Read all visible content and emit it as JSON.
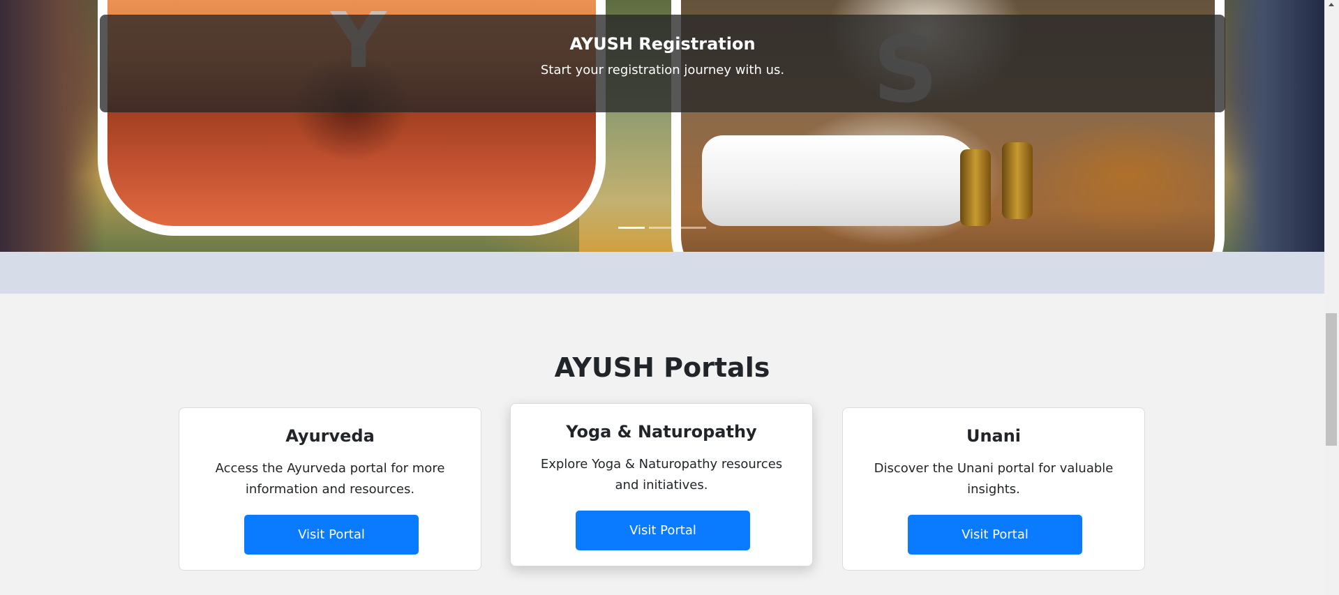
{
  "hero": {
    "caption_title": "AYUSH Registration",
    "caption_text": "Start your registration journey with us.",
    "tile_letters": [
      "Y",
      "S"
    ],
    "indicators": [
      {
        "active": true
      },
      {
        "active": false
      },
      {
        "active": false
      }
    ]
  },
  "portals": {
    "section_title": "AYUSH Portals",
    "cards": [
      {
        "title": "Ayurveda",
        "text": "Access the Ayurveda portal for more information and resources.",
        "button": "Visit Portal"
      },
      {
        "title": "Yoga & Naturopathy",
        "text": "Explore Yoga & Naturopathy resources and initiatives.",
        "button": "Visit Portal"
      },
      {
        "title": "Unani",
        "text": "Discover the Unani portal for valuable insights.",
        "button": "Visit Portal"
      }
    ]
  },
  "colors": {
    "primary_button": "#0a7bff",
    "page_background": "#f2f2f2",
    "caption_overlay": "#282828"
  }
}
